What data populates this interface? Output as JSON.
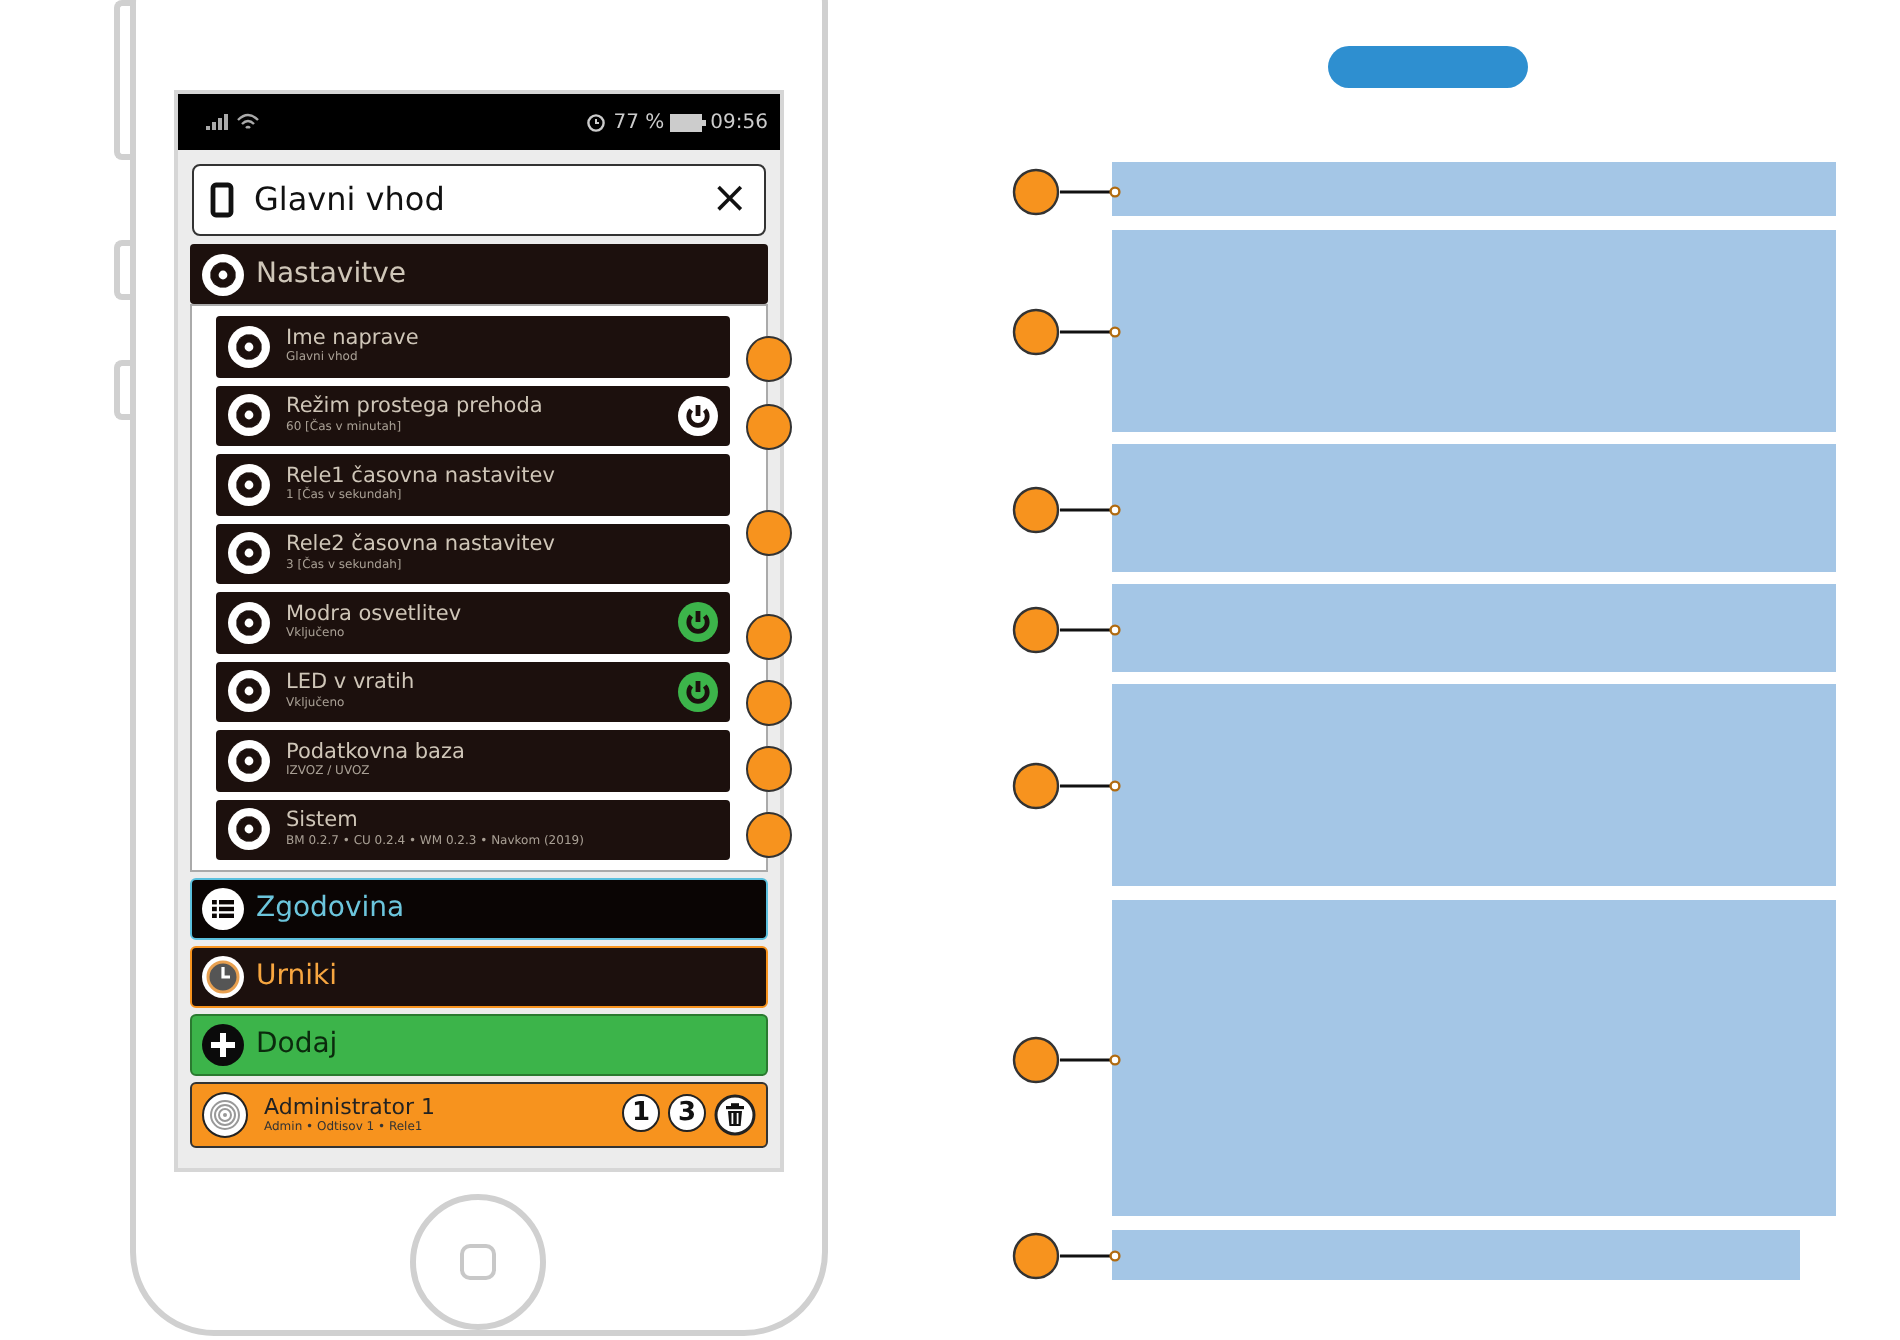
{
  "status_bar": {
    "battery": "77 %",
    "time": "09:56"
  },
  "header": {
    "title": "Glavni vhod",
    "close": "×"
  },
  "settings": {
    "title": "Nastavitve",
    "items": [
      {
        "title": "Ime naprave",
        "subtitle": "Glavni vhod",
        "kind": "plain"
      },
      {
        "title": "Režim prostega prehoda",
        "subtitle": "60 [Čas v minutah]",
        "kind": "toggle",
        "on": false
      },
      {
        "title": "Rele1 časovna nastavitev",
        "subtitle": "1 [Čas v sekundah]",
        "kind": "plain"
      },
      {
        "title": "Rele2 časovna nastavitev",
        "subtitle": "3 [Čas v sekundah]",
        "kind": "plain"
      },
      {
        "title": "Modra osvetlitev",
        "subtitle": "Vključeno",
        "kind": "toggle",
        "on": true
      },
      {
        "title": "LED v vratih",
        "subtitle": "Vključeno",
        "kind": "toggle",
        "on": true
      },
      {
        "title": "Podatkovna baza",
        "subtitle": "IZVOZ / UVOZ",
        "kind": "plain"
      },
      {
        "title": "Sistem",
        "subtitle": "BM 0.2.7 • CU 0.2.4 • WM 0.2.3 • Navkom (2019)",
        "kind": "plain"
      }
    ]
  },
  "sections": [
    {
      "label": "Zgodovina",
      "kind": "history"
    },
    {
      "label": "Urniki",
      "kind": "schedule"
    },
    {
      "label": "Dodaj",
      "kind": "add"
    }
  ],
  "user": {
    "name": "Administrator 1",
    "details": "Admin • Odtisov 1 • Rele1",
    "badges": [
      "1",
      "3"
    ]
  }
}
